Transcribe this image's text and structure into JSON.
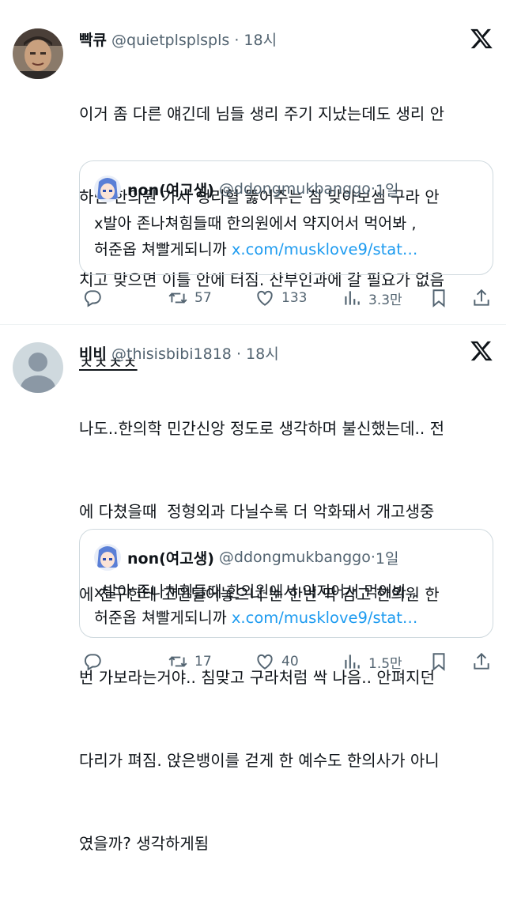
{
  "tweets": [
    {
      "name": "빡큐",
      "handle": "@quietplsplspls",
      "time": "18시",
      "text_lines": [
        "이거 좀 다른 얘긴데 님들 생리 주기 지났는데도 생리 안",
        "하면 한의원 가서 생리혈 뚫어주는 침 맞아보셈 구라 안",
        "치고 맞으면 이틀 안에 터짐. 산부인과에 갈 필요가 없음"
      ],
      "text_underlined": "ㅊㅊㅊㅊ",
      "quote": {
        "name": "non(여고생)",
        "handle": "@ddongmukbanggo",
        "time": "1일",
        "line1": "x발아 존나쳐힘들때 한의원에서 약지어서 먹어봐 ,",
        "line2": "허준옵 쳐빨게되니까 ",
        "link": "x.com/musklove9/stat…"
      },
      "stats": {
        "replies": "",
        "retweets": "57",
        "likes": "133",
        "views": "3.3만"
      }
    },
    {
      "name": "비비",
      "handle": "@thisisbibi1818",
      "time": "18시",
      "text_lines": [
        "나도..한의학 민간신앙 정도로 생각하며 불신했는데.. 전",
        "에 다쳤을때  정형외과 다닐수록 더 악화돼서 개고생중",
        "에 친구한테 고민털어놓으니 눈 한번 딱 감고 한의원 한",
        "번 가보라는거야.. 침맞고 구라처럼 싹 나음.. 안펴지던",
        "다리가 펴짐. 앉은뱅이를 걷게 한 예수도 한의사가 아니",
        "였을까? 생각하게됨"
      ],
      "quote": {
        "name": "non(여고생)",
        "handle": "@ddongmukbanggo",
        "time": "1일",
        "line1": "x발아 존나쳐힘들때 한의원에서 약지어서 먹어봐 ,",
        "line2": "허준옵 쳐빨게되니까 ",
        "link": "x.com/musklove9/stat…"
      },
      "stats": {
        "replies": "",
        "retweets": "17",
        "likes": "40",
        "views": "1.5만"
      }
    }
  ],
  "separator": "·",
  "colors": {
    "secondary": "#536471",
    "link": "#1d9bf0",
    "border": "#cfd9de"
  },
  "icons": [
    "x-logo-icon",
    "reply-icon",
    "retweet-icon",
    "like-icon",
    "views-icon",
    "bookmark-icon",
    "share-icon"
  ]
}
